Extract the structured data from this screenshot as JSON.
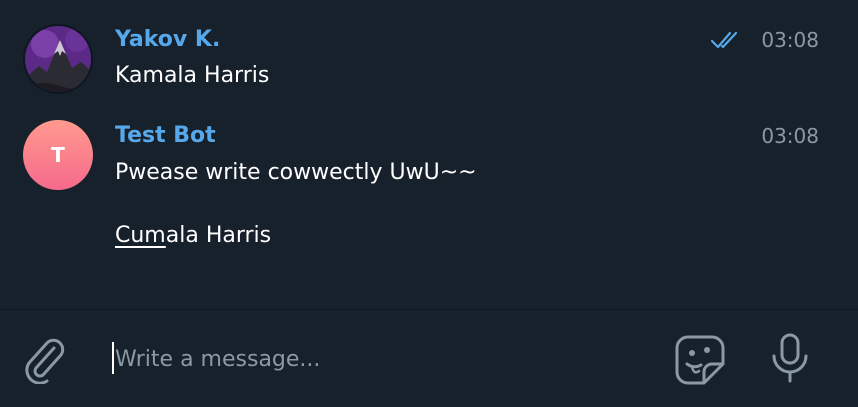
{
  "messages": [
    {
      "sender": "Yakov K.",
      "time": "03:08",
      "status": "read",
      "avatar_icon": "mountain-avatar",
      "text": "Kamala Harris"
    },
    {
      "sender": "Test Bot",
      "time": "03:08",
      "avatar_letter": "T",
      "line1": "Pwease write cowwectly UwU~~",
      "line2_underlined": "Cum",
      "line2_rest": "ala Harris"
    }
  ],
  "composer": {
    "placeholder": "Write a message...",
    "attach_icon": "paperclip-icon",
    "sticker_icon": "sticker-face-icon",
    "mic_icon": "microphone-icon"
  },
  "colors": {
    "background": "#17212b",
    "sender_name": "#57a8eb",
    "time": "#8b98a5",
    "read_checks": "#57a8eb",
    "avatar_gradient_top": "#ff9a8e",
    "avatar_gradient_bottom": "#f56a8b"
  }
}
